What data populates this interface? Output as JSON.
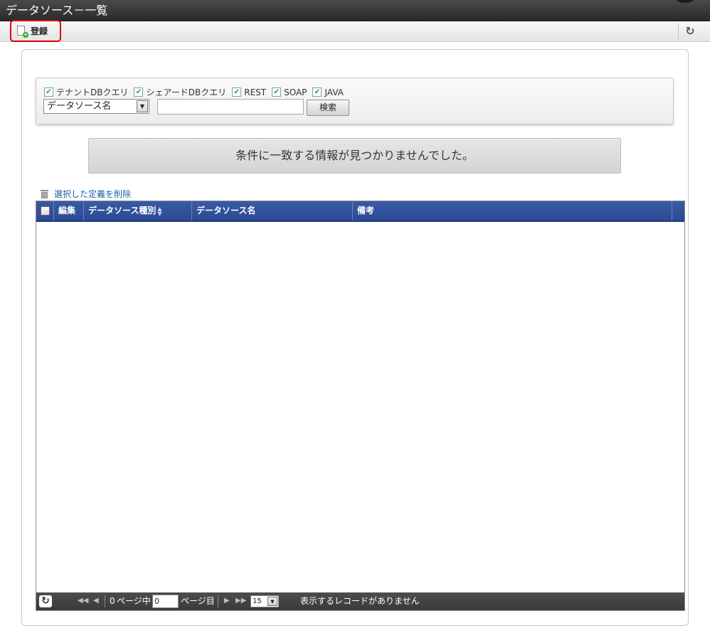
{
  "window": {
    "title": "データソース－一覧"
  },
  "toolbar": {
    "register_label": "登録"
  },
  "search": {
    "filters": [
      {
        "label": "テナントDBクエリ",
        "checked": true
      },
      {
        "label": "シェアードDBクエリ",
        "checked": true
      },
      {
        "label": "REST",
        "checked": true
      },
      {
        "label": "SOAP",
        "checked": true
      },
      {
        "label": "JAVA",
        "checked": true
      }
    ],
    "field_select_value": "データソース名",
    "keyword_value": "",
    "search_button_label": "検索"
  },
  "message": {
    "text": "条件に一致する情報が見つかりませんでした。"
  },
  "actions": {
    "delete_selected_label": "選択した定義を削除"
  },
  "grid": {
    "columns": [
      "編集",
      "データソース種別",
      "データソース名",
      "備考"
    ],
    "rows": []
  },
  "pager": {
    "total_prefix": "0",
    "total_suffix": "ページ中",
    "current_page": "0",
    "current_suffix": "ページ目",
    "page_size": "15",
    "status_text": "表示するレコードがありません"
  },
  "colors": {
    "header_blue": "#2f4f9c",
    "highlight_red": "#e00000",
    "pager_dark": "#444444"
  }
}
